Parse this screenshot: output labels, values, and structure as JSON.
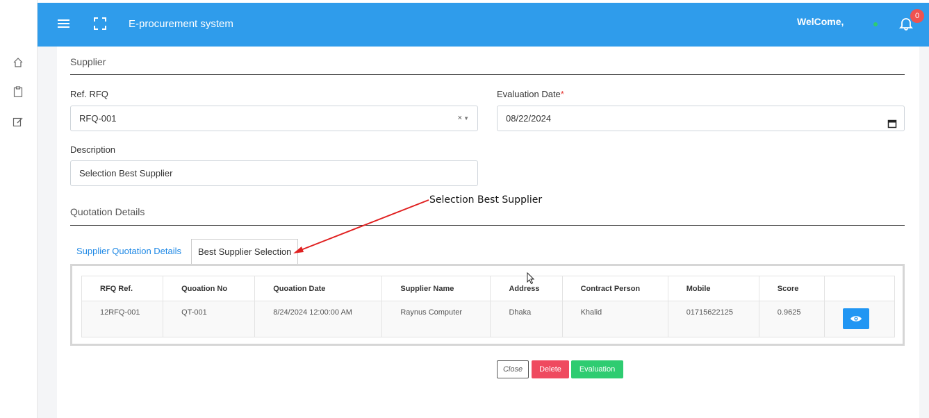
{
  "header": {
    "app_title": "E-procurement system",
    "welcome_text": "WelCome,",
    "notification_count": "0"
  },
  "sidebar": {
    "items": [
      {
        "icon": "home-icon"
      },
      {
        "icon": "clipboard-icon"
      },
      {
        "icon": "edit-icon"
      }
    ]
  },
  "form": {
    "section_title": "Supplier",
    "ref_rfq_label": "Ref. RFQ",
    "ref_rfq_value": "RFQ-001",
    "ref_rfq_clear": "×",
    "ref_rfq_caret": "▼",
    "evaluation_date_label": "Evaluation Date",
    "evaluation_date_required": "*",
    "evaluation_date_value": "08/22/2024",
    "description_label": "Description",
    "description_value": "Selection Best Supplier"
  },
  "quotation": {
    "section_title": "Quotation Details",
    "tabs": [
      {
        "label": "Supplier Quotation Details",
        "active": false
      },
      {
        "label": "Best Supplier Selection",
        "active": true
      }
    ],
    "table": {
      "headers": [
        "RFQ Ref.",
        "Quoation No",
        "Quoation Date",
        "Supplier Name",
        "Address",
        "Contract Person",
        "Mobile",
        "Score",
        ""
      ],
      "rows": [
        [
          "12RFQ-001",
          "QT-001",
          "8/24/2024 12:00:00 AM",
          "Raynus Computer",
          "Dhaka",
          "Khalid",
          "01715622125",
          "0.9625"
        ]
      ]
    }
  },
  "actions": {
    "close_label": "Close",
    "delete_label": "Delete",
    "evaluation_label": "Evaluation"
  },
  "annotation": {
    "text": "Selection Best Supplier"
  },
  "colors": {
    "header_bg": "#2f9ceb",
    "delete": "#ef4a5f",
    "evaluation": "#2ecc71",
    "view_button": "#2196f3",
    "annotation_arrow": "#e02020"
  }
}
